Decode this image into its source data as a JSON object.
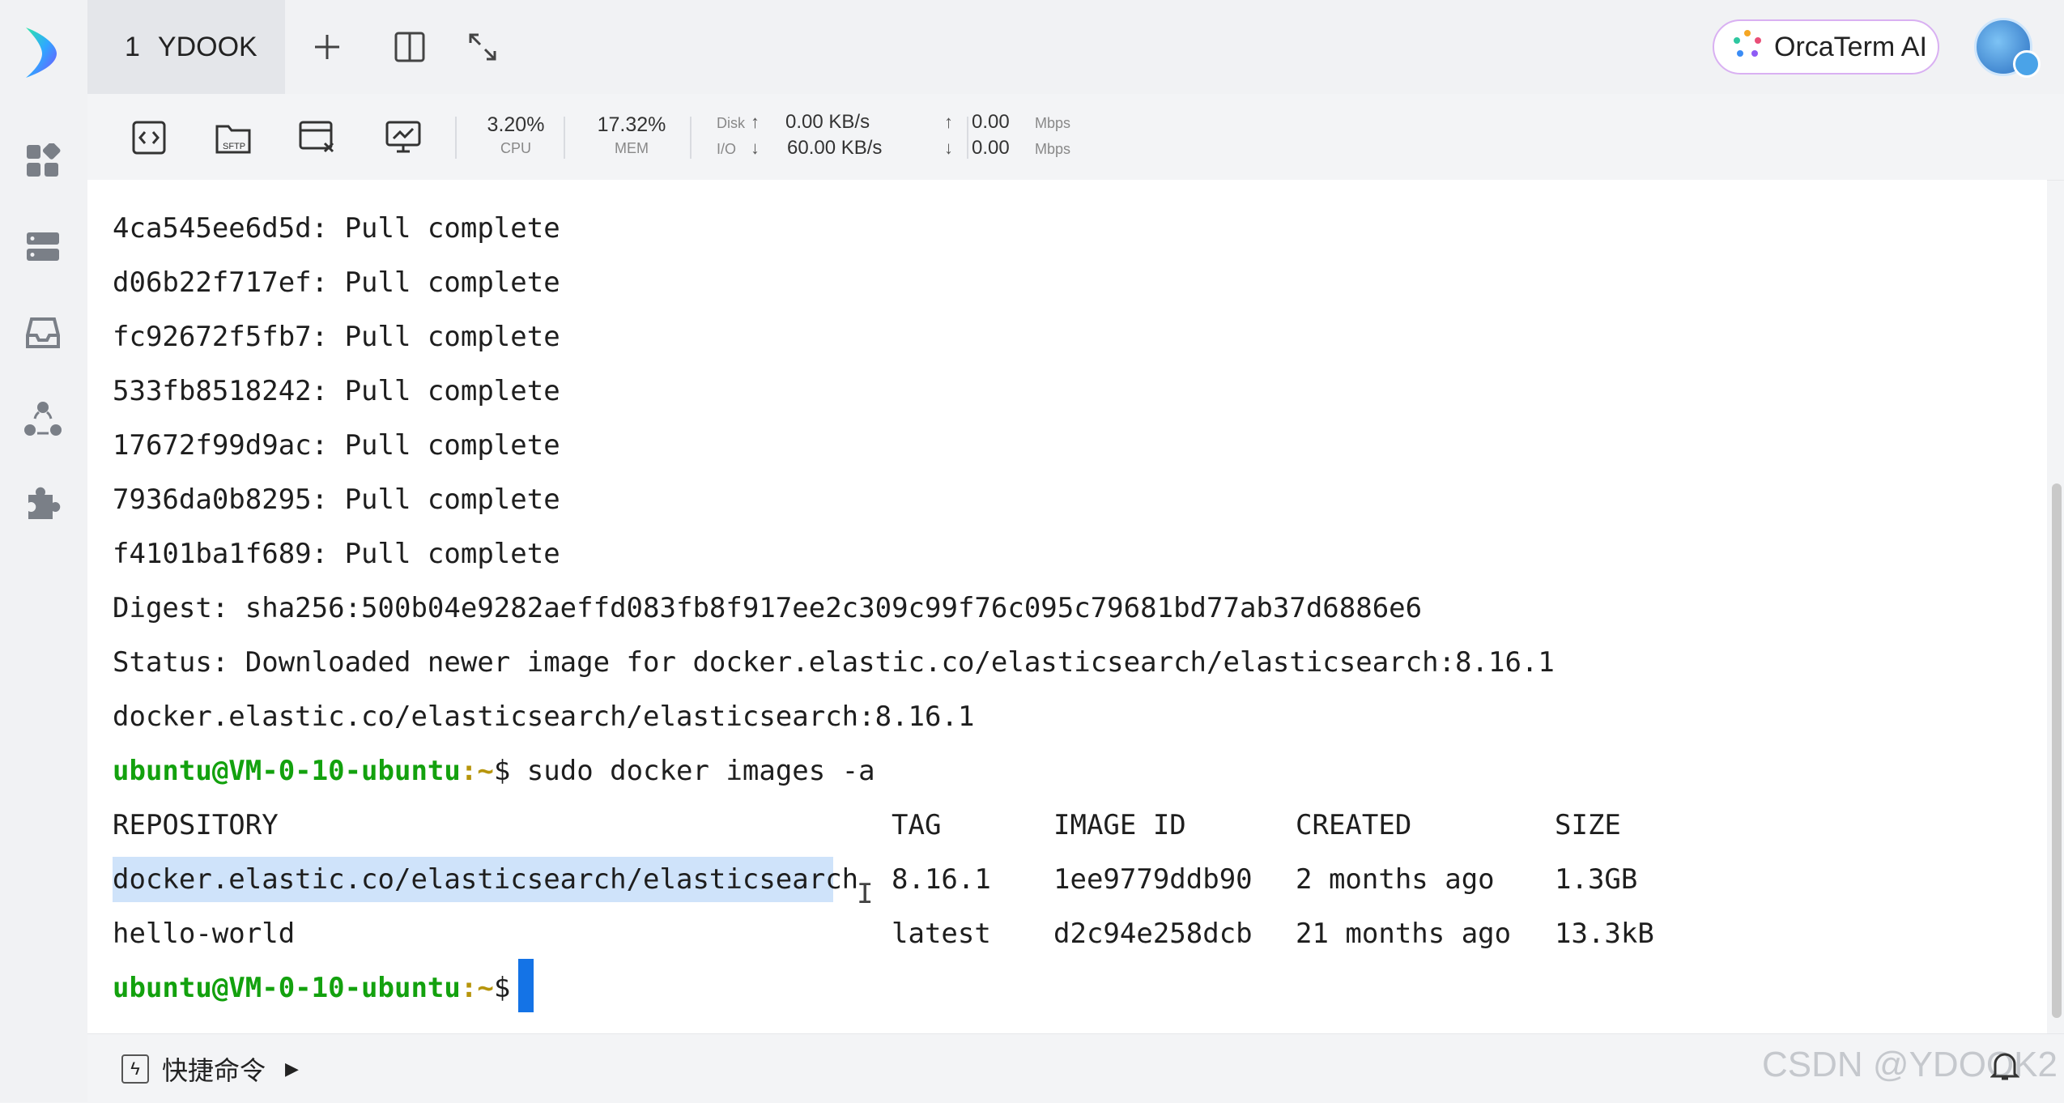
{
  "app": {
    "tab": {
      "number": "1",
      "name": "YDOOK"
    },
    "ai_button_label": "OrcaTerm AI"
  },
  "stats": {
    "cpu": {
      "value": "3.20%",
      "label": "CPU"
    },
    "mem": {
      "value": "17.32%",
      "label": "MEM"
    },
    "disk_io": {
      "label_top": "Disk",
      "label_bottom": "I/O",
      "read": "0.00 KB/s",
      "write": "60.00 KB/s"
    },
    "network": {
      "up": "0.00",
      "down": "0.00",
      "unit_up": "Mbps",
      "unit_down": "Mbps"
    }
  },
  "terminal": {
    "lines": [
      "4ca545ee6d5d: Pull complete",
      "d06b22f717ef: Pull complete",
      "fc92672f5fb7: Pull complete",
      "533fb8518242: Pull complete",
      "17672f99d9ac: Pull complete",
      "7936da0b8295: Pull complete",
      "f4101ba1f689: Pull complete",
      "Digest: sha256:500b04e9282aeffd083fb8f917ee2c309c99f76c095c79681bd77ab37d6886e6",
      "Status: Downloaded newer image for docker.elastic.co/elasticsearch/elasticsearch:8.16.1",
      "docker.elastic.co/elasticsearch/elasticsearch:8.16.1"
    ],
    "prompt_user": "ubuntu@VM-0-10-ubuntu",
    "prompt_path": ":~",
    "prompt_symbol": "$",
    "command": " sudo docker images -a",
    "table": {
      "headers": [
        "REPOSITORY",
        "TAG",
        "IMAGE ID",
        "CREATED",
        "SIZE"
      ],
      "rows": [
        [
          "docker.elastic.co/elasticsearch/elasticsearch",
          "8.16.1",
          "1ee9779ddb90",
          "2 months ago",
          "1.3GB"
        ],
        [
          "hello-world",
          "latest",
          "d2c94e258dcb",
          "21 months ago",
          "13.3kB"
        ]
      ]
    }
  },
  "bottom": {
    "quick_commands_label": "快捷命令",
    "watermark": "CSDN @YDOOK2"
  }
}
